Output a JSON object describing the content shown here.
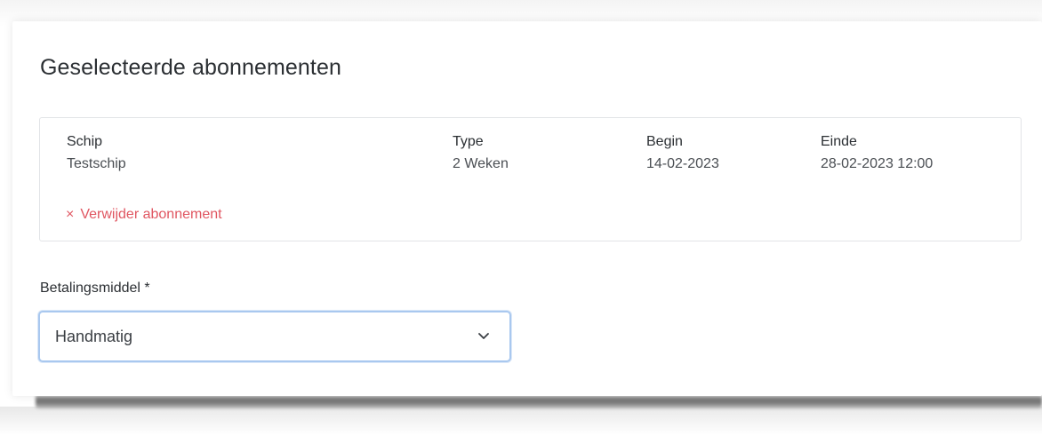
{
  "title": "Geselecteerde abonnementen",
  "subscription": {
    "columns": [
      {
        "header": "Schip",
        "value": "Testschip"
      },
      {
        "header": "Type",
        "value": "2 Weken"
      },
      {
        "header": "Begin",
        "value": "14-02-2023"
      },
      {
        "header": "Einde",
        "value": "28-02-2023 12:00"
      }
    ],
    "remove_icon": "×",
    "remove_label": "Verwijder abonnement"
  },
  "payment": {
    "label": "Betalingsmiddel *",
    "selected": "Handmatig",
    "icon": "chevron-down-icon"
  },
  "colors": {
    "danger": "#e05661",
    "focus_border": "#a9c8ef"
  }
}
